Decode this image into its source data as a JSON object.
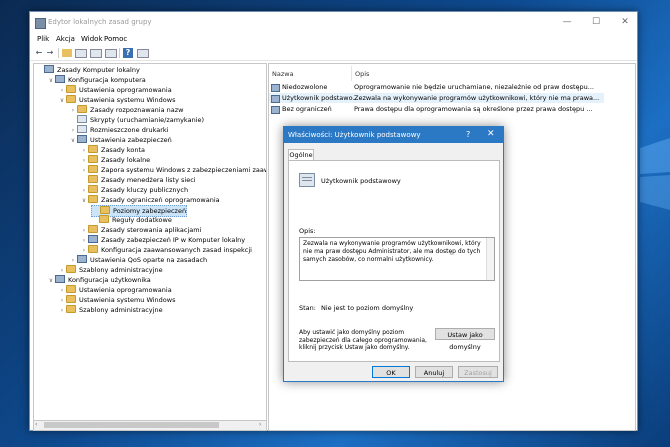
{
  "window": {
    "title": "Edytor lokalnych zasad grupy",
    "controls": [
      "—",
      "☐",
      "✕"
    ]
  },
  "menu": [
    "Plik",
    "Akcja",
    "Widok",
    "Pomoc"
  ],
  "tree": [
    {
      "label": "Zasady Komputer lokalny",
      "indent": 0,
      "arrow": "",
      "icon": "policy"
    },
    {
      "label": "Konfiguracja komputera",
      "indent": 1,
      "arrow": "∨",
      "icon": "policy"
    },
    {
      "label": "Ustawienia oprogramowania",
      "indent": 2,
      "arrow": "›",
      "icon": "folder"
    },
    {
      "label": "Ustawienia systemu Windows",
      "indent": 2,
      "arrow": "∨",
      "icon": "folder"
    },
    {
      "label": "Zasady rozpoznawania nazw",
      "indent": 3,
      "arrow": "›",
      "icon": "folder"
    },
    {
      "label": "Skrypty (uruchamianie/zamykanie)",
      "indent": 3,
      "arrow": "",
      "icon": "docico"
    },
    {
      "label": "Rozmieszczone drukarki",
      "indent": 3,
      "arrow": "›",
      "icon": "docico"
    },
    {
      "label": "Ustawienia zabezpieczeń",
      "indent": 3,
      "arrow": "∨",
      "icon": "policy"
    },
    {
      "label": "Zasady konta",
      "indent": 4,
      "arrow": "›",
      "icon": "folder"
    },
    {
      "label": "Zasady lokalne",
      "indent": 4,
      "arrow": "›",
      "icon": "folder"
    },
    {
      "label": "Zapora systemu Windows z zabezpieczeniami zaawansowa",
      "indent": 4,
      "arrow": "›",
      "icon": "folder"
    },
    {
      "label": "Zasady menedżera listy sieci",
      "indent": 4,
      "arrow": "",
      "icon": "folder"
    },
    {
      "label": "Zasady kluczy publicznych",
      "indent": 4,
      "arrow": "›",
      "icon": "folder"
    },
    {
      "label": "Zasady ograniczeń oprogramowania",
      "indent": 4,
      "arrow": "∨",
      "icon": "folder"
    },
    {
      "label": "Poziomy zabezpieczeń",
      "indent": 5,
      "arrow": "",
      "icon": "folder",
      "selected": true
    },
    {
      "label": "Reguły dodatkowe",
      "indent": 5,
      "arrow": "",
      "icon": "folder"
    },
    {
      "label": "Zasady sterowania aplikacjami",
      "indent": 4,
      "arrow": "›",
      "icon": "folder"
    },
    {
      "label": "Zasady zabezpieczeń IP w Komputer lokalny",
      "indent": 4,
      "arrow": "›",
      "icon": "policy"
    },
    {
      "label": "Konfiguracja zaawansowanych zasad inspekcji",
      "indent": 4,
      "arrow": "›",
      "icon": "folder"
    },
    {
      "label": "Ustawienia QoS oparte na zasadach",
      "indent": 3,
      "arrow": "›",
      "icon": "policy"
    },
    {
      "label": "Szablony administracyjne",
      "indent": 2,
      "arrow": "›",
      "icon": "folder"
    },
    {
      "label": "Konfiguracja użytkownika",
      "indent": 1,
      "arrow": "∨",
      "icon": "policy"
    },
    {
      "label": "Ustawienia oprogramowania",
      "indent": 2,
      "arrow": "›",
      "icon": "folder"
    },
    {
      "label": "Ustawienia systemu Windows",
      "indent": 2,
      "arrow": "›",
      "icon": "folder"
    },
    {
      "label": "Szablony administracyjne",
      "indent": 2,
      "arrow": "›",
      "icon": "folder"
    }
  ],
  "list": {
    "headers": {
      "name": "Nazwa",
      "desc": "Opis"
    },
    "rows": [
      {
        "name": "Niedozwolone",
        "desc": "Oprogramowanie nie będzie uruchamiane, niezależnie od praw dostępu..."
      },
      {
        "name": "Użytkownik podstawo...",
        "desc": "Zezwala na wykonywanie programów użytkownikowi, który nie ma prawa...",
        "highlight": true
      },
      {
        "name": "Bez ograniczeń",
        "desc": "Prawa dostępu dla oprogramowania są określone przez prawa dostępu ..."
      }
    ]
  },
  "dialog": {
    "title": "Właściwości: Użytkownik podstawowy",
    "help": "?",
    "close": "✕",
    "tab": "Ogólne",
    "heading": "Użytkownik podstawowy",
    "desc_label": "Opis:",
    "desc_text": "Zezwala na wykonywanie programów użytkownikowi, który nie ma praw dostępu Administrator, ale ma dostęp do tych samych zasobów, co normalni użytkownicy.",
    "status": "Stan:",
    "status_value": "Nie jest to poziom domyślny",
    "default_hint": "Aby ustawić jako domyślny poziom zabezpieczeń dla całego oprogramowania, kliknij przycisk Ustaw jako domyślny.",
    "set_default": "Ustaw jako domyślny",
    "ok": "OK",
    "cancel": "Anuluj",
    "apply": "Zastosuj"
  }
}
